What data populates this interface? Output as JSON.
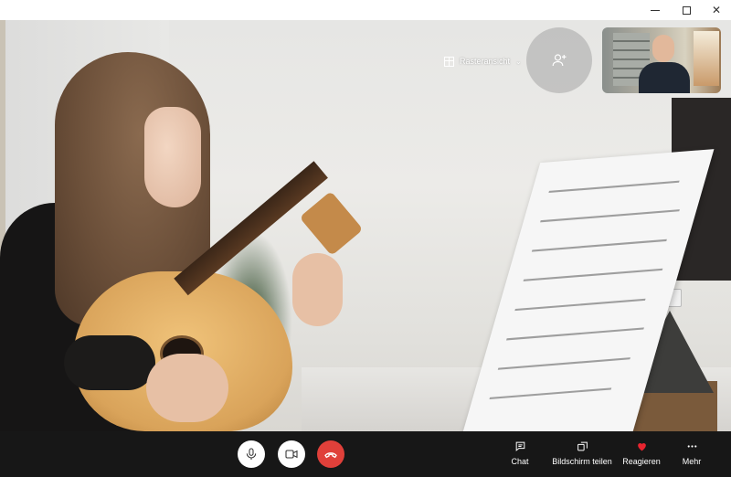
{
  "window": {
    "controls": [
      "minimize-icon",
      "maximize-icon",
      "close-icon"
    ]
  },
  "video_overlay": {
    "grid_view_label": "Rasteransicht",
    "grid_view_icon": "grid-icon",
    "dropdown_icon": "chevron-down-icon",
    "add_participant_icon": "add-person-icon"
  },
  "callbar": {
    "mic_icon": "microphone-icon",
    "camera_icon": "video-camera-icon",
    "hangup_icon": "hang-up-icon",
    "hangup_color": "#e0403a",
    "actions": [
      {
        "label": "Chat",
        "icon": "chat-icon"
      },
      {
        "label": "Bildschirm teilen",
        "icon": "share-screen-icon"
      },
      {
        "label": "Reagieren",
        "icon": "heart-icon",
        "color": "#e8242f"
      },
      {
        "label": "Mehr",
        "icon": "more-icon"
      }
    ]
  }
}
